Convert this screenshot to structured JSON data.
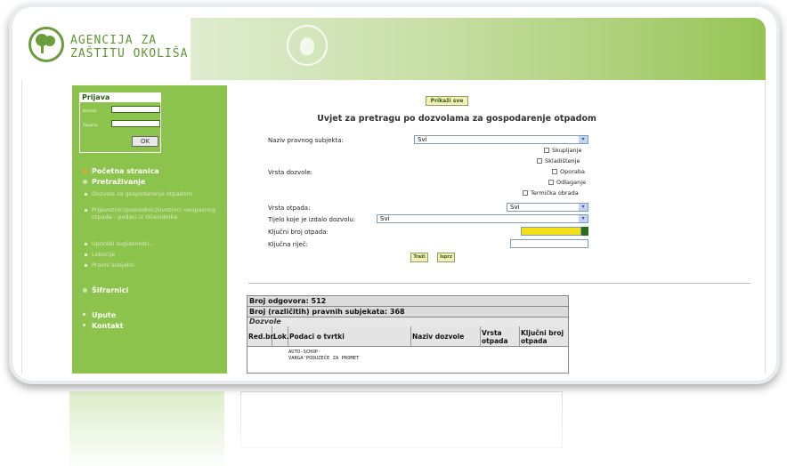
{
  "header": {
    "agency_line1": "AGENCIJA ZA",
    "agency_line2": "ZAŠTITU OKOLIŠA"
  },
  "login": {
    "title": "Prijava",
    "username_label": "Korisnik",
    "password_label": "Zaporka",
    "ok_label": "OK"
  },
  "nav": {
    "home": "Početna stranica",
    "search": "Pretraživanje",
    "search_items": [
      "Dozvole za gospodarenje otpadom",
      "Prijevoznici/posrednici/uvoznici neopasnog otpada - podaci iz Očevidnika",
      "Uporabi suglasnosti...",
      "Lokacije",
      "Pravni subjekti"
    ],
    "codebooks": "Šifrarnici",
    "instructions": "Upute",
    "contact": "Kontakt"
  },
  "search_form": {
    "show_all_label": "Prikaži sve",
    "title": "Uvjet za pretragu po dozvolama za gospodarenje otpadom",
    "legal_entity_label": "Naziv pravnog subjekta:",
    "legal_entity_value": "Svi",
    "permit_type_label": "Vrsta dozvole:",
    "permit_types": [
      "Skupljanje",
      "Skladištenje",
      "Oporaba",
      "Odlaganje",
      "Termička obrada"
    ],
    "waste_type_label": "Vrsta otpada:",
    "waste_type_value": "Svi",
    "issuer_label": "Tijelo koje je izdalo dozvolu:",
    "issuer_value": "Svi",
    "waste_code_label": "Ključni broj otpada:",
    "keyword_label": "Ključna riječ:",
    "search_label": "Traži",
    "clear_label": "Isprz"
  },
  "results": {
    "answers_count": "Broj odgovora: 512",
    "entities_count": "Broj (različitih) pravnih subjekata: 368",
    "section_title": "Dozvole",
    "columns": [
      "Red.br.",
      "Lok.",
      "Podaci o tvrtki",
      "Naziv dozvole",
      "Vrsta otpada",
      "Ključni broj otpada"
    ],
    "first_row_company": "AUTO-SCHOP-VARGA'PODUZEĆE ZA PROMET"
  },
  "colors": {
    "sidebar_green": "#8cc34c",
    "header_green": "#96c455",
    "logo_green": "#5d9630",
    "highlight_yellow": "#f2e11a"
  }
}
